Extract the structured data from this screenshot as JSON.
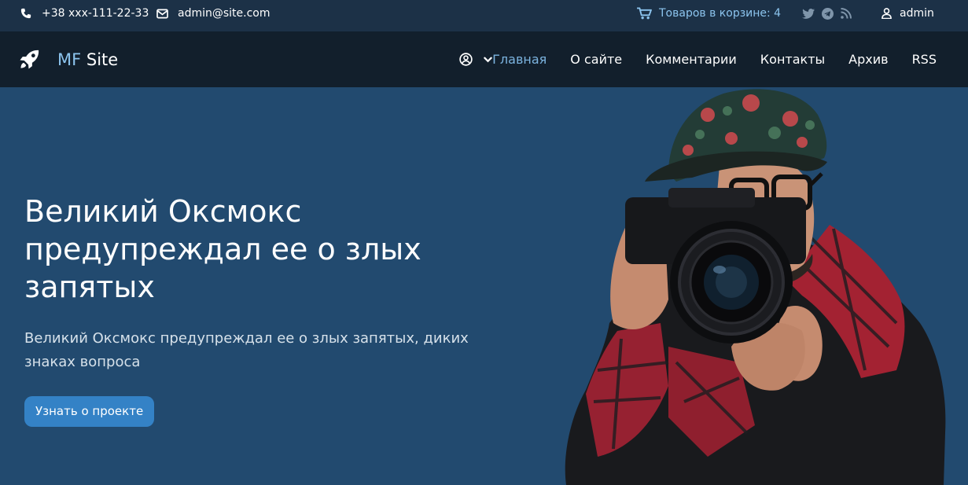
{
  "topbar": {
    "phone": "+38 xxx-111-22-33",
    "email": "admin@site.com",
    "cart_label": "Товаров в корзине: 4",
    "user": "admin"
  },
  "navbar": {
    "brand_mf": "MF",
    "brand_site": "Site",
    "links": [
      {
        "label": "Главная",
        "active": true
      },
      {
        "label": "О сайте"
      },
      {
        "label": "Комментарии"
      },
      {
        "label": "Контакты"
      },
      {
        "label": "Архив"
      },
      {
        "label": "RSS"
      }
    ]
  },
  "hero": {
    "title": "Великий Оксмокс предупреждал ее о злых запятых",
    "subtitle": "Великий Оксмокс предупреждал ее о злых запятых, диких знаках вопроса",
    "button": "Узнать о проекте",
    "image": "photographer-with-camera-image"
  },
  "colors": {
    "topbar_bg": "#1c3147",
    "navbar_bg": "#121f2c",
    "hero_bg": "#224a6f",
    "accent": "#3482c6",
    "active_link": "#7cb4e0"
  }
}
